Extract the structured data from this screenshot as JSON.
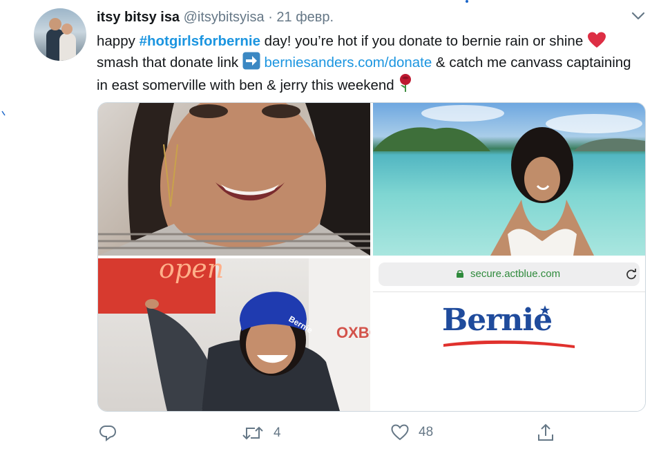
{
  "tweet": {
    "display_name": "itsy bitsy isa",
    "handle": "@itsybitsyisa",
    "separator": "·",
    "time": "21 февр.",
    "text": {
      "p1": "happy ",
      "hashtag": "#hotgirlsforbernie",
      "p2": " day! you’re hot if you donate to bernie rain or shine ",
      "p3": " smash that donate link ",
      "link": "berniesanders.com/donate",
      "p4": " & catch me canvass captaining in east somerville with ben & jerry this weekend "
    }
  },
  "media": {
    "browser_url": "secure.actblue.com",
    "logo_text": "Bernie",
    "neon_sign": "open",
    "beanie_text": "Bernie",
    "wall_text": "OXBO"
  },
  "actions": {
    "reply_count": "",
    "retweet_count": "4",
    "like_count": "48"
  },
  "colors": {
    "link": "#1b95e0",
    "secondary_text": "#657786",
    "heart_emoji": "#dd2e44",
    "bernie_blue": "#1f4b9c",
    "bernie_red": "#e0312d"
  },
  "icons": [
    "chevron-down-icon",
    "red-heart-emoji",
    "right-arrow-emoji",
    "rose-emoji",
    "reply-icon",
    "retweet-icon",
    "like-icon",
    "share-icon",
    "lock-icon",
    "reload-icon"
  ]
}
